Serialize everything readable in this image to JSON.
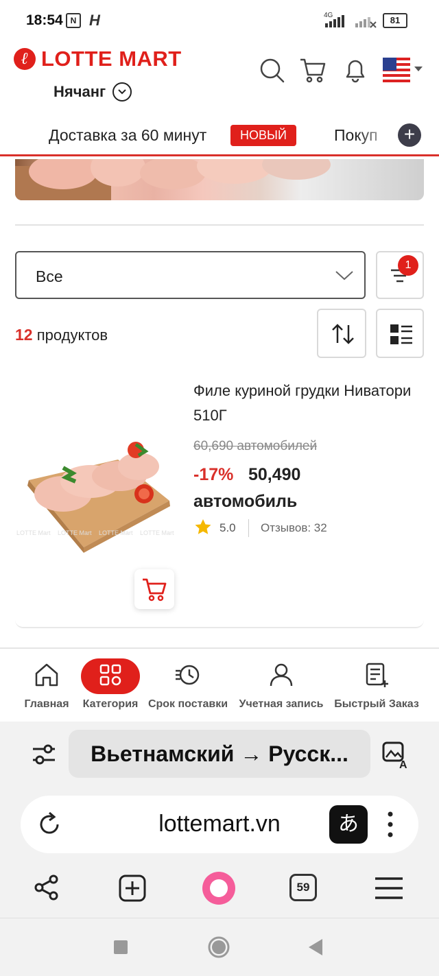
{
  "status_bar": {
    "time": "18:54",
    "network": "4G",
    "battery": "81"
  },
  "header": {
    "logo_text": "LOTTE MART",
    "logo_mark": "ℓ",
    "city": "Нячанг",
    "icons": [
      "search-icon",
      "cart-icon",
      "bell-icon",
      "us-flag-icon"
    ]
  },
  "tabs": {
    "delivery": "Доставка за 60 минут",
    "new_badge": "НОВЫЙ",
    "shopping": "Покуп"
  },
  "filters": {
    "category_select": "Все",
    "filter_count": "1",
    "product_count_num": "12",
    "product_count_label": "продуктов"
  },
  "product": {
    "name": "Филе куриной грудки Ниватори 510Г",
    "old_price": "60,690 автомобилей",
    "discount": "-17%",
    "price": "50,490",
    "unit": "автомобиль",
    "rating": "5.0",
    "reviews": "Отзывов: 32",
    "watermark": "LOTTE Mart"
  },
  "bottom_nav": {
    "items": [
      {
        "label": "Главная",
        "icon": "home-icon"
      },
      {
        "label": "Категория",
        "icon": "category-grid-icon"
      },
      {
        "label": "Срок поставки",
        "icon": "clock-history-icon"
      },
      {
        "label": "Учетная запись",
        "icon": "user-icon"
      },
      {
        "label": "Быстрый Заказ",
        "icon": "quick-order-icon"
      }
    ]
  },
  "browser": {
    "translate_label": "Вьетнамский → Русск...",
    "url": "lottemart.vn",
    "translate_glyph": "あ",
    "tab_count": "59"
  },
  "colors": {
    "brand_red": "#e0201b",
    "text": "#222222"
  }
}
